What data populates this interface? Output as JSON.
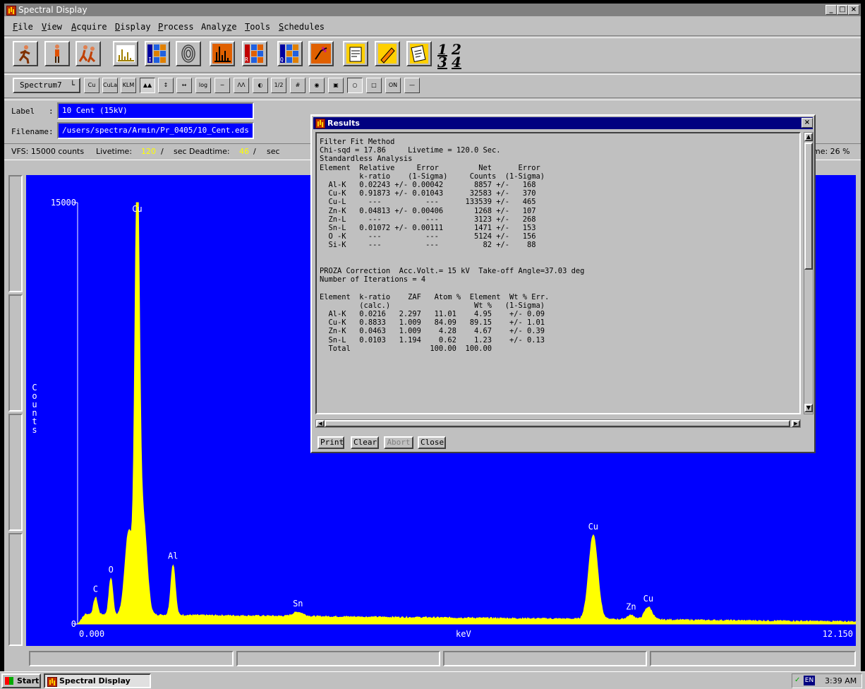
{
  "window": {
    "title": "Spectral Display",
    "controls": [
      "_",
      "□",
      "×"
    ]
  },
  "menu": [
    "File",
    "View",
    "Acquire",
    "Display",
    "Process",
    "Analyze",
    "Tools",
    "Schedules"
  ],
  "menu_underline": [
    "F",
    "V",
    "A",
    "D",
    "P",
    "z",
    "T",
    "S"
  ],
  "toolbar1": {
    "icons": [
      "runner-icon",
      "standing-person-icon",
      "running-pair-icon",
      "spectrum-bar-icon",
      "id-map-icon",
      "fingerprint-icon",
      "orange-spectrum-icon",
      "r-map-icon",
      "q-map-icon",
      "percent-chart-icon",
      "clipboard-icon",
      "pencil-icon",
      "report-icon"
    ],
    "quad": [
      "1",
      "2",
      "3",
      "4"
    ]
  },
  "toolbar2": {
    "spectrum_select": "Spectrum7",
    "buttons": [
      "Cu",
      "CuLa",
      "KLM",
      "▲▲",
      "↕",
      "↔",
      "log",
      "─",
      "ΛΛ",
      "◐",
      "1/2",
      "#",
      "◉",
      "▣",
      "○",
      "□",
      "ON",
      "—"
    ]
  },
  "fields": {
    "label_caption": "Label",
    "label_colon": ":",
    "label_value": "10 Cent (15kV)",
    "filename_caption": "Filename:",
    "filename_value": "/users/spectra/Armin/Pr_0405/10_Cent.eds"
  },
  "statusline": {
    "vfs": "VFS: 15000 counts",
    "livetime_label": "Livetime:",
    "livetime_value": "120",
    "livetime_sep": "/",
    "sec_deadtime": "sec Deadtime:",
    "deadtime_value": "46",
    "deadtime_sep": "/",
    "sec": "sec",
    "right_info": "me:  26 %"
  },
  "chart_data": {
    "type": "line",
    "title": "",
    "xlabel": "keV",
    "ylabel": "Counts",
    "xlim": [
      0.0,
      12.15
    ],
    "ylim": [
      0,
      15000
    ],
    "x_tick_labels": [
      "0.000",
      "12.150"
    ],
    "y_tick_labels": [
      "15000",
      "0"
    ],
    "colors": {
      "background": "#0000ff",
      "trace": "#ffff00",
      "text": "#ffffff"
    },
    "peaks": [
      {
        "label": "C",
        "x": 0.28,
        "y": 600,
        "sigma": 0.03
      },
      {
        "label": "O",
        "x": 0.52,
        "y": 1300,
        "sigma": 0.03
      },
      {
        "label": "Cu",
        "x": 0.93,
        "y": 15000,
        "sigma": 0.035
      },
      {
        "label": "Al",
        "x": 1.49,
        "y": 1800,
        "sigma": 0.035
      },
      {
        "label": "Sn",
        "x": 3.44,
        "y": 150,
        "sigma": 0.08
      },
      {
        "label": "Cu",
        "x": 8.05,
        "y": 3000,
        "sigma": 0.07
      },
      {
        "label": "Zn",
        "x": 8.64,
        "y": 150,
        "sigma": 0.06
      },
      {
        "label": "Cu",
        "x": 8.91,
        "y": 450,
        "sigma": 0.06
      }
    ],
    "extra_components": [
      {
        "x": 0.8,
        "y": 3000,
        "sigma": 0.06
      },
      {
        "x": 1.02,
        "y": 3500,
        "sigma": 0.06
      }
    ],
    "background": {
      "start": 350,
      "end": 80
    }
  },
  "results": {
    "title": "Results",
    "text": "Filter Fit Method\nChi-sqd = 17.86     Livetime = 120.0 Sec.\nStandardless Analysis\nElement  Relative     Error         Net      Error\n         k-ratio    (1-Sigma)     Counts  (1-Sigma)\n  Al-K   0.02243 +/- 0.00042       8857 +/-   168\n  Cu-K   0.91873 +/- 0.01043      32583 +/-   370\n  Cu-L     ---          ---      133539 +/-   465\n  Zn-K   0.04813 +/- 0.00406       1268 +/-   107\n  Zn-L     ---          ---        3123 +/-   268\n  Sn-L   0.01072 +/- 0.00111       1471 +/-   153\n  O -K     ---          ---        5124 +/-   156\n  Si-K     ---          ---          82 +/-    88\n\n\nPROZA Correction  Acc.Volt.= 15 kV  Take-off Angle=37.03 deg\nNumber of Iterations = 4\n\nElement  k-ratio    ZAF   Atom %  Element  Wt % Err.\n         (calc.)                   Wt %   (1-Sigma)\n  Al-K   0.0216   2.297   11.01    4.95    +/- 0.09\n  Cu-K   0.8833   1.009   84.09   89.15    +/- 1.01\n  Zn-K   0.0463   1.009    4.28    4.67    +/- 0.39\n  Sn-L   0.0103   1.194    0.62    1.23    +/- 0.13\n  Total                  100.00  100.00",
    "buttons": {
      "print": "Print",
      "clear": "Clear",
      "abort": "Abort",
      "close": "Close"
    }
  },
  "taskbar": {
    "start": "Start",
    "task": "Spectral Display",
    "lang": "EN",
    "clock": "3:39 AM"
  }
}
